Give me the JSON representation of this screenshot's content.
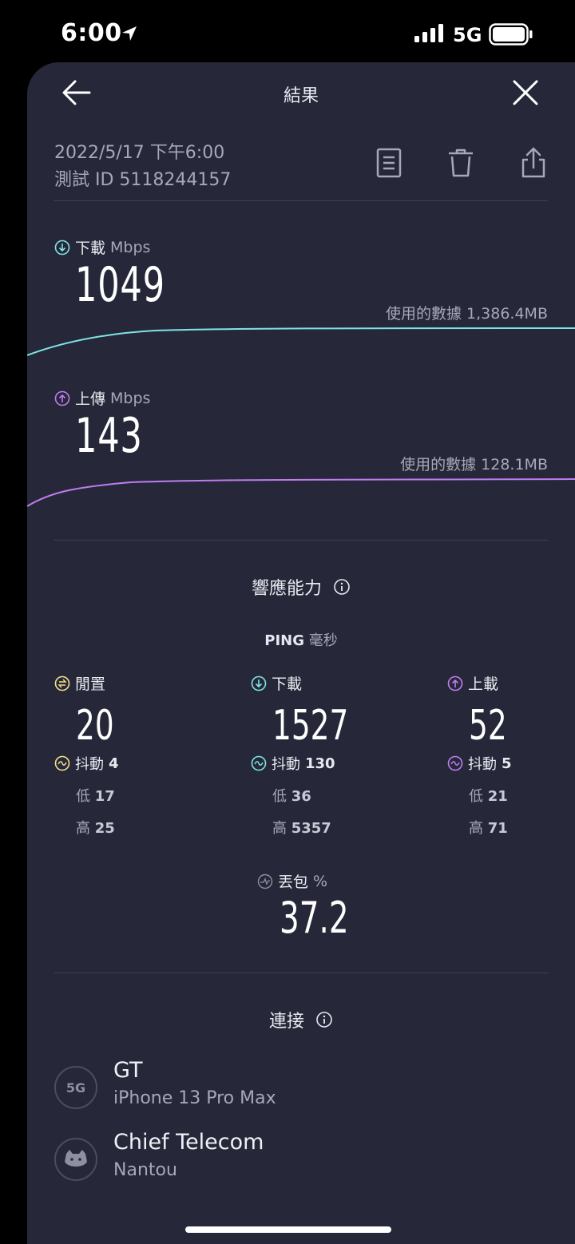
{
  "status_bar": {
    "time": "6:00",
    "network": "5G"
  },
  "nav": {
    "title": "結果"
  },
  "meta": {
    "date": "2022/5/17 下午6:00",
    "test_id": "測試 ID 5118244157"
  },
  "download": {
    "label": "下載",
    "unit": "Mbps",
    "value": "1049",
    "data_used": "使用的數據 1,386.4MB"
  },
  "upload": {
    "label": "上傳",
    "unit": "Mbps",
    "value": "143",
    "data_used": "使用的數據 128.1MB"
  },
  "responsiveness": {
    "title": "響應能力",
    "ping_label": "PING",
    "ping_unit": "毫秒",
    "columns": [
      {
        "label": "閒置",
        "value": "20",
        "jitter_label": "抖動",
        "jitter": "4",
        "low_label": "低",
        "low": "17",
        "high_label": "高",
        "high": "25"
      },
      {
        "label": "下載",
        "value": "1527",
        "jitter_label": "抖動",
        "jitter": "130",
        "low_label": "低",
        "low": "36",
        "high_label": "高",
        "high": "5357"
      },
      {
        "label": "上載",
        "value": "52",
        "jitter_label": "抖動",
        "jitter": "5",
        "low_label": "低",
        "low": "21",
        "high_label": "高",
        "high": "71"
      }
    ],
    "packet_loss_label": "丟包",
    "packet_loss_unit": "%",
    "packet_loss": "37.2"
  },
  "connection": {
    "title": "連接",
    "items": [
      {
        "badge": "5G",
        "name": "GT",
        "sub": "iPhone 13 Pro Max"
      },
      {
        "badge": "",
        "name": "Chief Telecom",
        "sub": "Nantou"
      }
    ]
  },
  "colors": {
    "download": "#7fe3e6",
    "upload": "#c07cf0",
    "idle": "#f2e08a",
    "background": "#262839"
  }
}
